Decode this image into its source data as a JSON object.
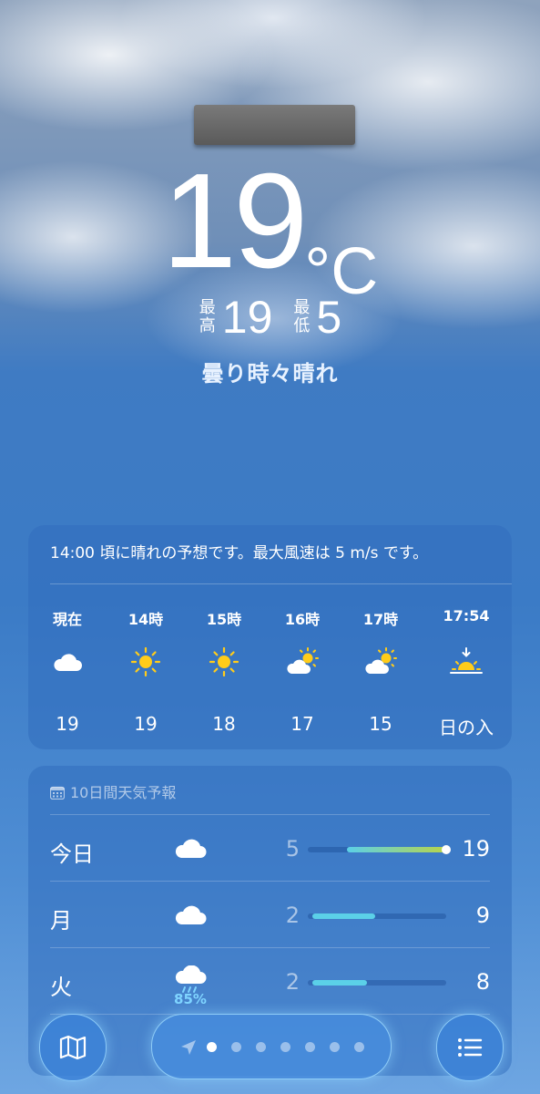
{
  "current": {
    "temperature": "19",
    "unit": "°C",
    "high_label": "最高",
    "high": "19",
    "low_label": "最低",
    "low": "5",
    "condition": "曇り時々晴れ"
  },
  "hourly": {
    "summary": "14:00 頃に晴れの予想です。最大風速は 5 m/s です。",
    "items": [
      {
        "time": "現在",
        "icon": "cloud-icon",
        "value": "19"
      },
      {
        "time": "14時",
        "icon": "sun-icon",
        "value": "19"
      },
      {
        "time": "15時",
        "icon": "sun-icon",
        "value": "18"
      },
      {
        "time": "16時",
        "icon": "partly-cloudy-icon",
        "value": "17"
      },
      {
        "time": "17時",
        "icon": "partly-cloudy-icon",
        "value": "15"
      },
      {
        "time": "17:54",
        "icon": "sunset-icon",
        "value": "日の入"
      }
    ]
  },
  "daily": {
    "title": "10日間天気予報",
    "rows": [
      {
        "day": "今日",
        "icon": "cloud-icon",
        "precip": "",
        "low": "5",
        "high": "19",
        "range_start": 0.28,
        "range_end": 1.0,
        "current_marker": 1.0
      },
      {
        "day": "月",
        "icon": "cloud-icon",
        "precip": "",
        "low": "2",
        "high": "9",
        "range_start": 0.03,
        "range_end": 0.49
      },
      {
        "day": "火",
        "icon": "rain-icon",
        "precip": "85%",
        "low": "2",
        "high": "8",
        "range_start": 0.03,
        "range_end": 0.43
      }
    ]
  },
  "toolbar": {
    "map_icon": "map-icon",
    "list_icon": "list-icon",
    "page_count": 7,
    "active_page": 1
  },
  "colors": {
    "sky_blue": "#3b7bc6",
    "card_bg": "rgba(50,110,190,0.55)",
    "bar_fill": "#5bd0e8",
    "precip_text": "#7fd4ff",
    "sun": "#ffcc1a"
  }
}
